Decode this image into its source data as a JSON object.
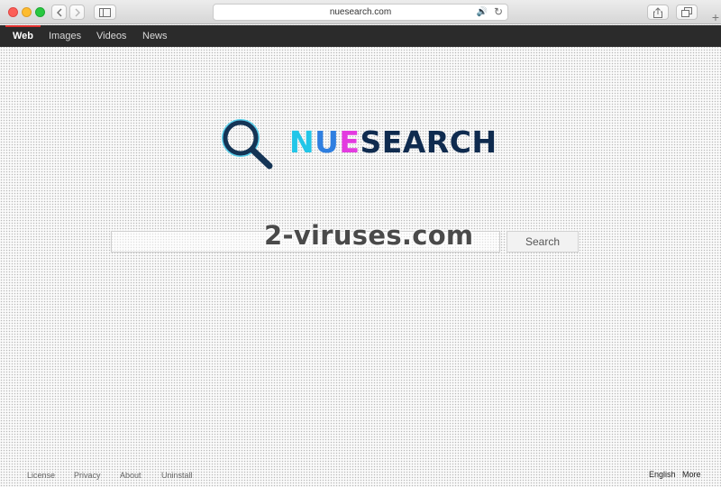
{
  "browser": {
    "url": "nuesearch.com",
    "icons": {
      "back": "chevron-left-icon",
      "forward": "chevron-right-icon",
      "sidebar": "sidebar-icon",
      "audio": "speaker-icon",
      "reload": "reload-icon",
      "share": "share-icon",
      "tabs": "tabs-icon",
      "new_tab": "plus-icon"
    }
  },
  "nav": {
    "items": [
      {
        "label": "Web",
        "active": true
      },
      {
        "label": "Images",
        "active": false
      },
      {
        "label": "Videos",
        "active": false
      },
      {
        "label": "News",
        "active": false
      }
    ],
    "active_color": "#e0312f"
  },
  "logo": {
    "part1": "N",
    "part2": "U",
    "part3": "E",
    "part4": "SEARCH",
    "colors": {
      "n": "#22c6e8",
      "u": "#2f7fe0",
      "e": "#e33be0",
      "search": "#0f2b4f",
      "icon_ring": "#143455"
    }
  },
  "search": {
    "value": "",
    "placeholder": "",
    "button_label": "Search"
  },
  "watermark": "2-viruses.com",
  "footer": {
    "links": [
      "License",
      "Privacy",
      "About",
      "Uninstall"
    ],
    "language": "English",
    "more": "More"
  }
}
